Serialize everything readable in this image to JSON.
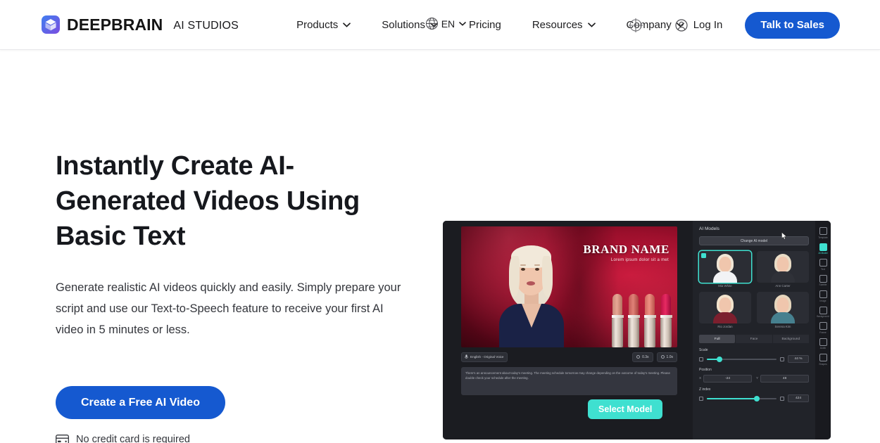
{
  "header": {
    "brand": {
      "name": "DEEPBRAIN",
      "sub": "AI STUDIOS",
      "icon": "cube-logo-icon"
    },
    "nav": [
      {
        "label": "Products",
        "has_dropdown": true
      },
      {
        "label": "Solutions",
        "has_dropdown": true
      },
      {
        "label": "Pricing",
        "has_dropdown": false
      },
      {
        "label": "Resources",
        "has_dropdown": true
      },
      {
        "label": "Company",
        "has_dropdown": true
      }
    ],
    "language": {
      "label": "EN",
      "icon": "globe-icon"
    },
    "login": {
      "label": "Log In",
      "icon": "user-circle-icon"
    },
    "cta": {
      "label": "Talk to Sales"
    }
  },
  "hero": {
    "headline": "Instantly Create AI-Generated Videos Using Basic Text",
    "subcopy": "Generate realistic AI videos quickly and easily. Simply prepare your script and use our Text-to-Speech feature to receive your first AI video in 5 minutes or less.",
    "cta_label": "Create a Free AI Video",
    "note": "No credit card is required",
    "note_icon": "credit-card-icon"
  },
  "app_screenshot": {
    "canvas": {
      "title": "BRAND NAME",
      "subtitle": "Lorem ipsum dolor sit a met"
    },
    "toolbar": {
      "voice_chip": "English - Original Voice",
      "voice_icon": "microphone-icon",
      "timing_chips": [
        {
          "value": "0.3s",
          "icon": "clock-icon"
        },
        {
          "value": "1.0s",
          "icon": "clock-icon"
        }
      ]
    },
    "script_text": "There's an announcement about today's meeting. The meeting schedule tomorrow may change depending on the outcome of today's meeting. Please double check your schedule after the meeting.",
    "select_badge": "Select Model",
    "panel": {
      "title": "AI Models",
      "change_button": "Change AI model",
      "models": [
        {
          "name": "Mia White",
          "selected": true,
          "hair": "#f0e6d6",
          "outfit": "#f2f3f5"
        },
        {
          "name": "Ann Carter",
          "selected": false,
          "hair": "#e9dcc6",
          "outfit": "#2f3138"
        },
        {
          "name": "Rio Jordan",
          "selected": false,
          "hair": "#f3e4cd",
          "outfit": "#7c1f2e"
        },
        {
          "name": "Serena Kim",
          "selected": false,
          "hair": "#e6d6bd",
          "outfit": "#46808f"
        }
      ],
      "segments": [
        {
          "label": "Full",
          "active": true
        },
        {
          "label": "Face",
          "active": false
        },
        {
          "label": "Background",
          "active": false
        }
      ],
      "controls": {
        "scale": {
          "label": "Scale",
          "value": "44 %",
          "percent": 18
        },
        "position": {
          "label": "Position",
          "x_axis": "X",
          "x_value": "-24",
          "y_axis": "Y",
          "y_value": "48"
        },
        "z_index": {
          "label": "Z index",
          "value": "424",
          "percent": 72
        }
      }
    },
    "rail": [
      {
        "label": "Template",
        "icon": "template-icon",
        "active": false
      },
      {
        "label": "AI Model",
        "icon": "ai-model-icon",
        "active": true
      },
      {
        "label": "Text",
        "icon": "text-icon",
        "active": false
      },
      {
        "label": "Subtitle",
        "icon": "subtitle-icon",
        "active": false
      },
      {
        "label": "Image",
        "icon": "image-icon",
        "active": false
      },
      {
        "label": "Background",
        "icon": "background-icon",
        "active": false
      },
      {
        "label": "Frame",
        "icon": "frame-icon",
        "active": false
      },
      {
        "label": "Audio",
        "icon": "audio-icon",
        "active": false
      },
      {
        "label": "Shapes",
        "icon": "shapes-icon",
        "active": false
      }
    ]
  },
  "colors": {
    "brand_blue": "#1559d0",
    "accent_teal": "#3fe0d0",
    "text_dark": "#16181d",
    "page_bg": "#ffffff"
  }
}
